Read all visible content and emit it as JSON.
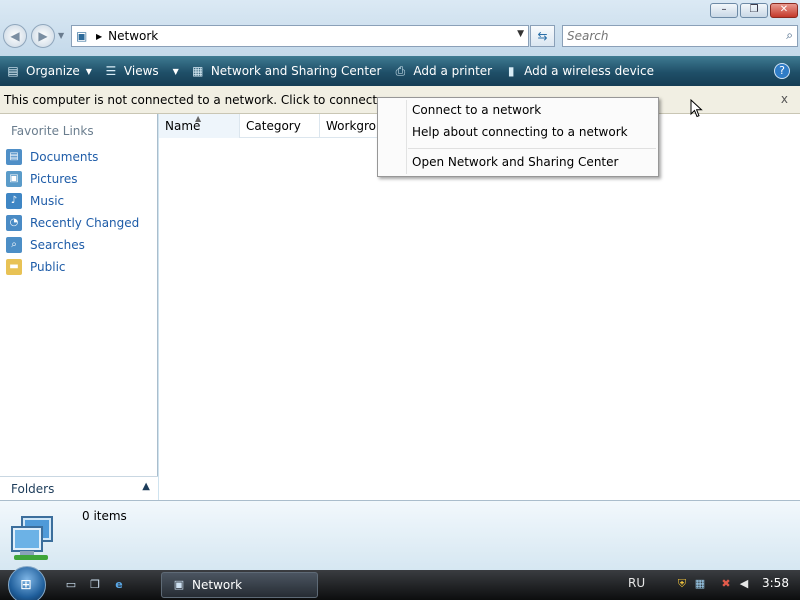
{
  "window": {
    "minimize_label": "–",
    "maximize_label": "❐",
    "close_label": "✕"
  },
  "address_bar": {
    "path": "Network",
    "search_placeholder": "Search"
  },
  "command_bar": {
    "organize": "Organize",
    "views": "Views",
    "network_sharing": "Network and Sharing Center",
    "add_printer": "Add a printer",
    "add_wireless": "Add a wireless device",
    "help": "?"
  },
  "info_bar": {
    "text": "This computer is not connected to a network. Click to connect...",
    "close": "x"
  },
  "left_nav": {
    "title": "Favorite Links",
    "items": [
      {
        "label": "Documents",
        "icon": "documents-icon",
        "color": "#4f8fc7"
      },
      {
        "label": "Pictures",
        "icon": "pictures-icon",
        "color": "#5a9bc9"
      },
      {
        "label": "Music",
        "icon": "music-icon",
        "color": "#3f86c4"
      },
      {
        "label": "Recently Changed",
        "icon": "recent-icon",
        "color": "#4a8bc5"
      },
      {
        "label": "Searches",
        "icon": "searches-icon",
        "color": "#4c8ec6"
      },
      {
        "label": "Public",
        "icon": "public-folder-icon",
        "color": "#e8c255"
      }
    ],
    "folders": "Folders"
  },
  "columns": [
    "Name",
    "Category",
    "Workgroup"
  ],
  "context_menu": {
    "connect": "Connect to a network",
    "help": "Help about connecting to a network",
    "open": "Open Network and Sharing Center"
  },
  "details": {
    "count": "0 items"
  },
  "taskbar": {
    "task_label": "Network",
    "language": "RU",
    "clock": "3:58"
  },
  "colors": {
    "command_bar": "#1f4f68",
    "link": "#1e5ca8",
    "info_bar": "#f1efe3"
  }
}
